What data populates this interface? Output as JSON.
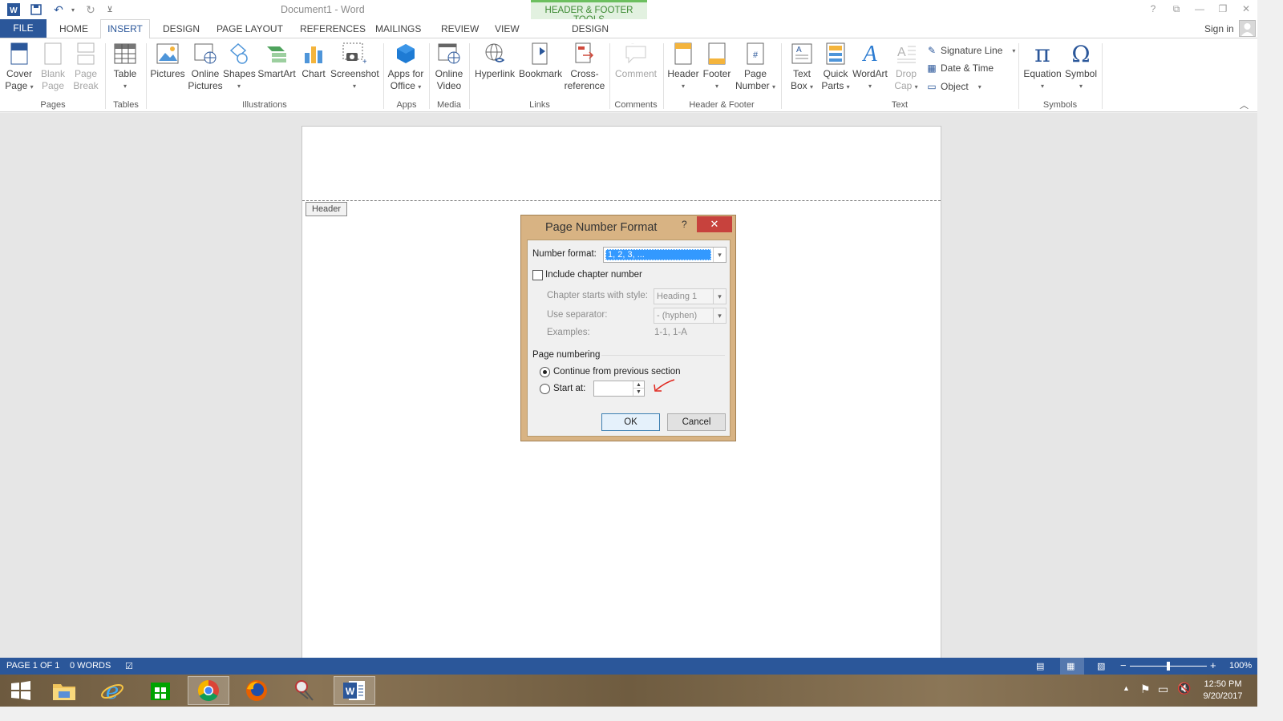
{
  "window": {
    "title": "Document1 - Word",
    "contextual_tab_group": "HEADER & FOOTER TOOLS",
    "help": "?",
    "sign_in": "Sign in"
  },
  "tabs": [
    "FILE",
    "HOME",
    "INSERT",
    "DESIGN",
    "PAGE LAYOUT",
    "REFERENCES",
    "MAILINGS",
    "REVIEW",
    "VIEW",
    "DESIGN"
  ],
  "ribbon": {
    "pages": {
      "label": "Pages",
      "cover_page": [
        "Cover",
        "Page"
      ],
      "blank_page": [
        "Blank",
        "Page"
      ],
      "page_break": [
        "Page",
        "Break"
      ]
    },
    "tables": {
      "label": "Tables",
      "table": "Table"
    },
    "illustrations": {
      "label": "Illustrations",
      "pictures": "Pictures",
      "online_pictures": [
        "Online",
        "Pictures"
      ],
      "shapes": "Shapes",
      "smartart": "SmartArt",
      "chart": "Chart",
      "screenshot": "Screenshot"
    },
    "apps": {
      "label": "Apps",
      "apps_for_office": [
        "Apps for",
        "Office"
      ]
    },
    "media": {
      "label": "Media",
      "online_video": [
        "Online",
        "Video"
      ]
    },
    "links": {
      "label": "Links",
      "hyperlink": "Hyperlink",
      "bookmark": "Bookmark",
      "cross_reference": [
        "Cross-",
        "reference"
      ]
    },
    "comments": {
      "label": "Comments",
      "comment": "Comment"
    },
    "header_footer": {
      "label": "Header & Footer",
      "header": "Header",
      "footer": "Footer",
      "page_number": [
        "Page",
        "Number"
      ]
    },
    "text": {
      "label": "Text",
      "text_box": [
        "Text",
        "Box"
      ],
      "quick_parts": [
        "Quick",
        "Parts"
      ],
      "wordart": "WordArt",
      "drop_cap": [
        "Drop",
        "Cap"
      ],
      "signature_line": "Signature Line",
      "date_time": "Date & Time",
      "object": "Object"
    },
    "symbols": {
      "label": "Symbols",
      "equation": "Equation",
      "symbol": "Symbol"
    }
  },
  "document": {
    "header_tag": "Header"
  },
  "dialog": {
    "title": "Page Number Format",
    "help": "?",
    "close": "✕",
    "number_format_label": "Number format:",
    "number_format_value": "1, 2, 3, ...",
    "include_chapter_label": "Include chapter number",
    "include_chapter_checked": false,
    "chapter_style_label": "Chapter starts with style:",
    "chapter_style_value": "Heading 1",
    "separator_label": "Use separator:",
    "separator_value": "-   (hyphen)",
    "examples_label": "Examples:",
    "examples_value": "1-1, 1-A",
    "page_numbering_label": "Page numbering",
    "continue_label": "Continue from previous section",
    "continue_selected": true,
    "start_at_label": "Start at:",
    "start_at_value": "",
    "ok": "OK",
    "cancel": "Cancel"
  },
  "status": {
    "page": "PAGE 1 OF 1",
    "words": "0 WORDS",
    "zoom": "100%"
  },
  "taskbar": {
    "items": [
      "start-icon",
      "file-explorer-icon",
      "internet-explorer-icon",
      "store-icon",
      "chrome-icon",
      "firefox-icon",
      "snipping-tool-icon",
      "word-icon"
    ],
    "time": "12:50 PM",
    "date": "9/20/2017"
  },
  "colors": {
    "word_blue": "#2b579a",
    "contextual_green": "#3d8a33",
    "dialog_frame": "#d8b383",
    "close_red": "#c7423d",
    "annotation_red": "#e0261d"
  }
}
